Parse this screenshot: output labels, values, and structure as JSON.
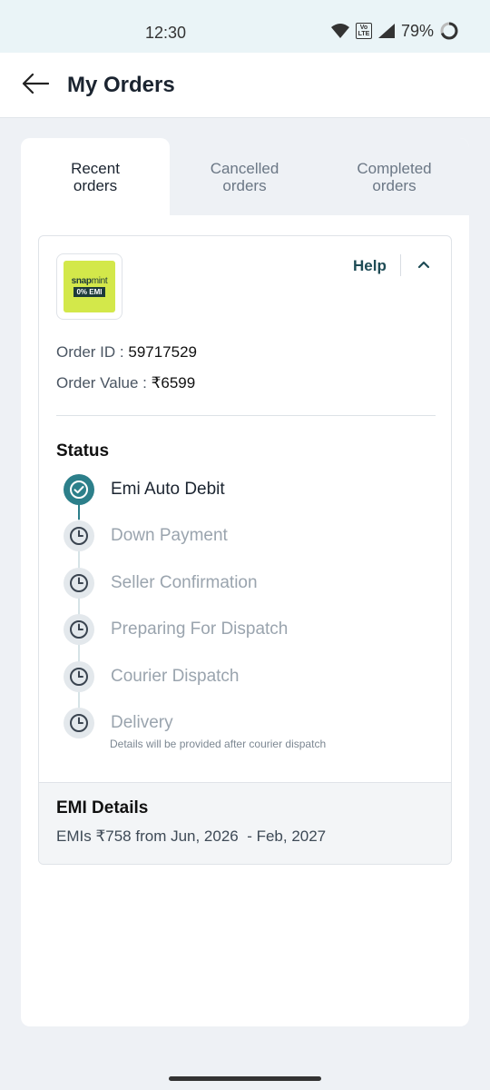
{
  "status_bar": {
    "time": "12:30",
    "battery": "79%",
    "volte": "Vo LTE"
  },
  "header": {
    "title": "My Orders"
  },
  "tabs": [
    {
      "label": "Recent\norders",
      "active": true
    },
    {
      "label": "Cancelled\norders",
      "active": false
    },
    {
      "label": "Completed\norders",
      "active": false
    }
  ],
  "order": {
    "logo_word_bold": "snap",
    "logo_word_light": "mint",
    "logo_tag": "0% EMI",
    "help_label": "Help",
    "order_id_label": "Order ID :",
    "order_id": "59717529",
    "order_value_label": "Order Value :",
    "order_value": "₹6599",
    "status_title": "Status",
    "steps": [
      {
        "label": "Emi Auto Debit",
        "state": "done",
        "icon": "check-icon"
      },
      {
        "label": "Down Payment",
        "state": "pending",
        "icon": "clock-icon"
      },
      {
        "label": "Seller Confirmation",
        "state": "pending",
        "icon": "clock-icon"
      },
      {
        "label": "Preparing For Dispatch",
        "state": "pending",
        "icon": "clock-icon"
      },
      {
        "label": "Courier Dispatch",
        "state": "pending",
        "icon": "clock-icon"
      },
      {
        "label": "Delivery",
        "state": "pending",
        "icon": "clock-icon"
      }
    ],
    "delivery_note": "Details will be provided after courier dispatch",
    "emi_title": "EMI Details",
    "emi_text": "EMIs ₹758 from Jun, 2026  - Feb, 2027"
  },
  "colors": {
    "accent": "#2c7f8a",
    "logo_bg": "#d3e84a",
    "help": "#1e4b55"
  }
}
